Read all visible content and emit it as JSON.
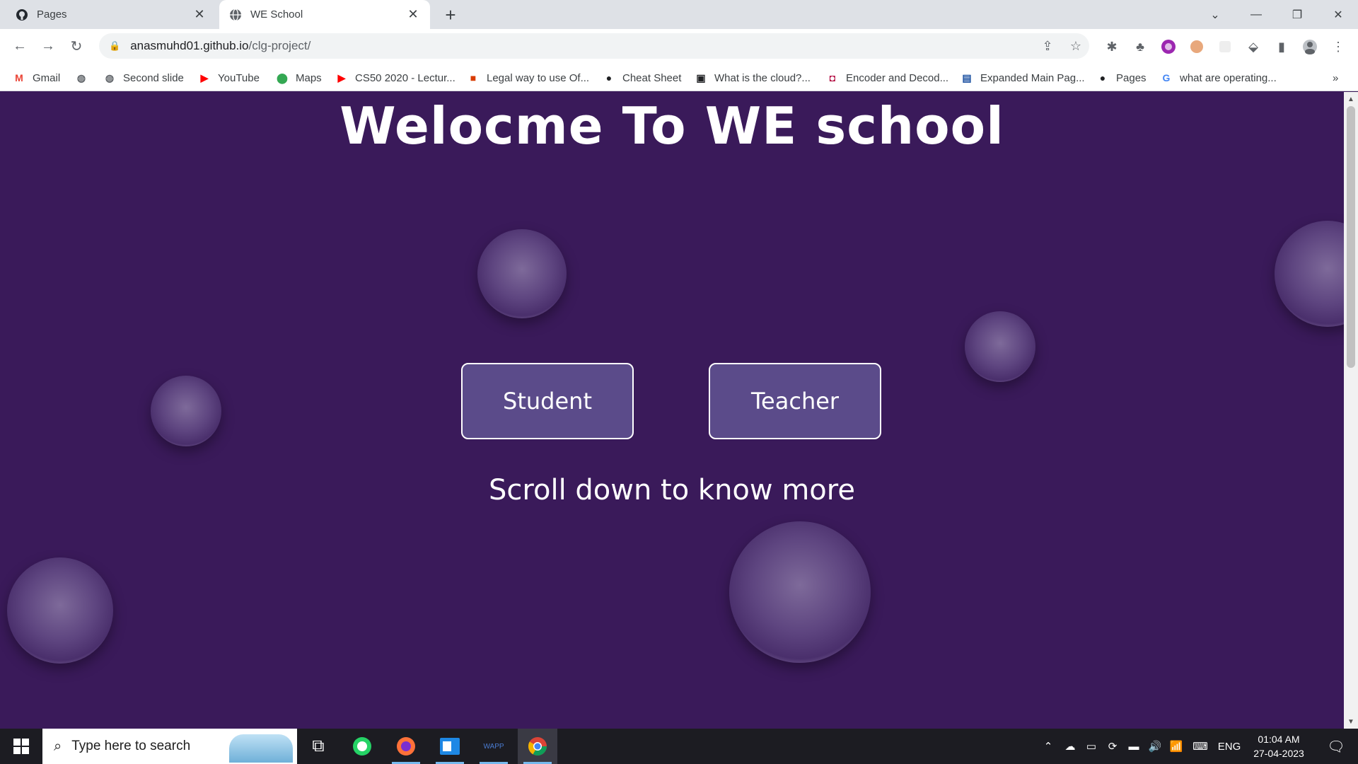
{
  "browser": {
    "tabs": [
      {
        "title": "Pages",
        "icon": "github-icon",
        "active": false
      },
      {
        "title": "WE School",
        "icon": "globe-icon",
        "active": true
      }
    ],
    "address": {
      "domain": "anasmuhd01.github.io",
      "path": "/clg-project/"
    },
    "bookmarks": [
      {
        "label": "Gmail",
        "icon": "gmail-icon",
        "color": "#ea4335"
      },
      {
        "label": "",
        "icon": "globe-icon",
        "color": "#5f6368"
      },
      {
        "label": "Second slide",
        "icon": "globe-icon",
        "color": "#5f6368"
      },
      {
        "label": "YouTube",
        "icon": "youtube-icon",
        "color": "#ff0000"
      },
      {
        "label": "Maps",
        "icon": "maps-icon",
        "color": "#34a853"
      },
      {
        "label": "CS50 2020 - Lectur...",
        "icon": "youtube-icon",
        "color": "#ff0000"
      },
      {
        "label": "Legal way to use Of...",
        "icon": "office-icon",
        "color": "#d83b01"
      },
      {
        "label": "Cheat Sheet",
        "icon": "cheatsheet-icon",
        "color": "#202124"
      },
      {
        "label": "What is the cloud?...",
        "icon": "terminal-icon",
        "color": "#202124"
      },
      {
        "label": "Encoder and Decod...",
        "icon": "chip-icon",
        "color": "#b0003a"
      },
      {
        "label": "Expanded Main Pag...",
        "icon": "table-icon",
        "color": "#1a4fa0"
      },
      {
        "label": "Pages",
        "icon": "github-icon",
        "color": "#202124"
      },
      {
        "label": "what are operating...",
        "icon": "google-icon",
        "color": "#4285f4"
      }
    ]
  },
  "page": {
    "headline": "Welocme To WE school",
    "student_label": "Student",
    "teacher_label": "Teacher",
    "scroll_text": "Scroll down to know more"
  },
  "taskbar": {
    "search_placeholder": "Type here to search",
    "apps": [
      "task-view-icon",
      "whatsapp-icon",
      "firefox-icon",
      "outlook-icon",
      "wapp-icon",
      "chrome-icon"
    ],
    "wapp_label": "WAPP",
    "language": "ENG",
    "time": "01:04 AM",
    "date": "27-04-2023"
  },
  "colors": {
    "page_bg": "#3a1a5a",
    "button_bg": "#5b4b8a",
    "accent": "#76b9ed"
  }
}
